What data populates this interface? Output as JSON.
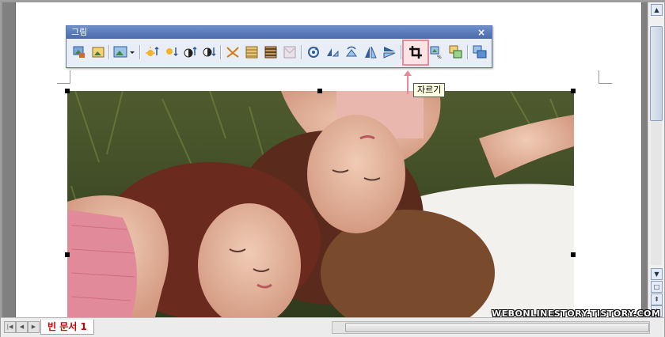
{
  "toolbar": {
    "title": "그림",
    "close_glyph": "×",
    "buttons": [
      {
        "name": "picture-insert-icon"
      },
      {
        "name": "picture-frame-icon"
      },
      {
        "name": "picture-style-icon"
      },
      {
        "name": "dropdown-arrow-icon"
      },
      {
        "name": "brightness-up-icon"
      },
      {
        "name": "brightness-down-icon"
      },
      {
        "name": "contrast-up-icon"
      },
      {
        "name": "contrast-down-icon"
      },
      {
        "name": "effect-original-icon"
      },
      {
        "name": "effect-grayscale-icon"
      },
      {
        "name": "effect-blackwhite-icon"
      },
      {
        "name": "effect-watermark-icon"
      },
      {
        "name": "rotate-icon"
      },
      {
        "name": "flip-icon"
      },
      {
        "name": "rotate-left-icon"
      },
      {
        "name": "mirror-horizontal-icon"
      },
      {
        "name": "mirror-vertical-icon"
      },
      {
        "name": "crop-icon"
      },
      {
        "name": "picture-size-icon"
      },
      {
        "name": "picture-replace-icon"
      },
      {
        "name": "picture-properties-icon"
      }
    ]
  },
  "tooltip": {
    "text": "자르기"
  },
  "document": {
    "tab_label": "빈 문서 1"
  },
  "watermark": {
    "text": "WEBONLINESTORY.TISTORY.COM"
  },
  "colors": {
    "accent_highlight": "#e58a98",
    "title_bar": "#5b7bb3",
    "tab_text": "#cc0000"
  }
}
